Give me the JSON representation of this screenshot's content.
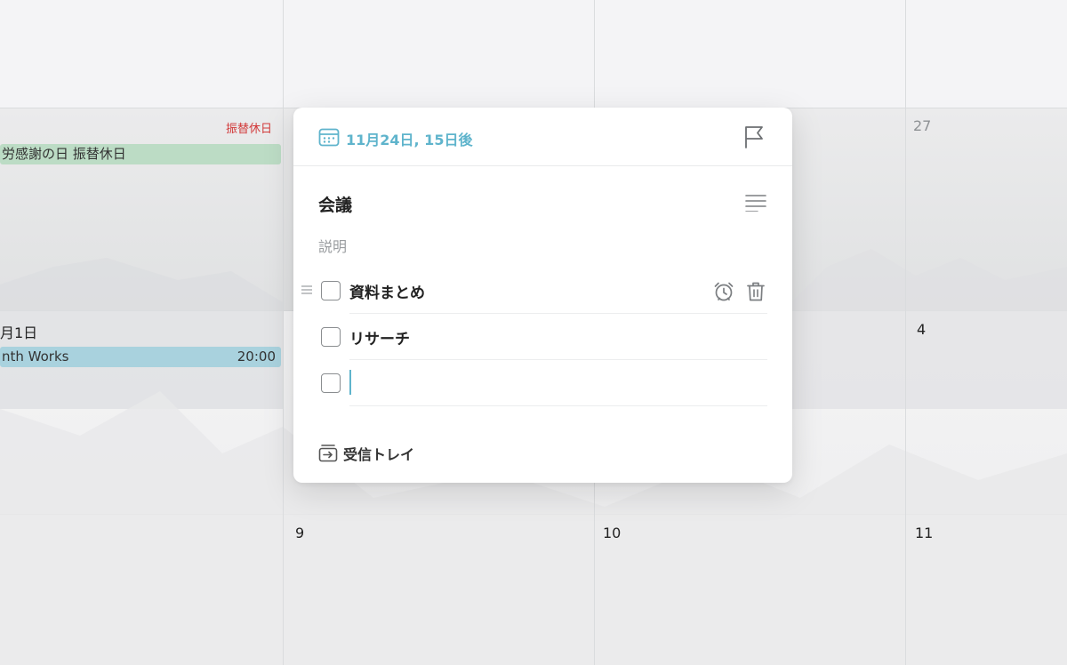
{
  "calendar": {
    "holiday_label": "振替休日",
    "events": {
      "holiday_event": "労感謝の日 振替休日",
      "month_event_title": "nth Works",
      "month_event_time": "20:00"
    },
    "day_numbers": {
      "top_right": "27",
      "month_start": "月1日",
      "right_4": "4",
      "d9": "9",
      "d10": "10",
      "d11": "11"
    },
    "colors": {
      "holiday_red": "#d23a3a",
      "holiday_event_bg": "#bcdcc5",
      "month_event_bg": "#a9d2de"
    }
  },
  "popup": {
    "date_text": "11月24日, 15日後",
    "date_icon": "calendar-icon",
    "flag_icon": "flag-icon",
    "title": "会議",
    "notes_icon": "notes-lines-icon",
    "description_placeholder": "説明",
    "subtasks": [
      {
        "label": "資料まとめ",
        "checked": false
      },
      {
        "label": "リサーチ",
        "checked": false
      }
    ],
    "new_subtask_value": "",
    "inbox_label": "受信トレイ",
    "accent_color": "#5fb4cc"
  }
}
